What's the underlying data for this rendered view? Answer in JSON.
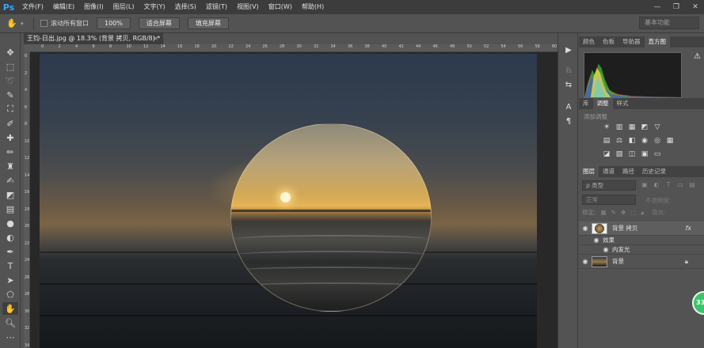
{
  "app": {
    "logo": "Ps"
  },
  "menu": [
    "文件(F)",
    "编辑(E)",
    "图像(I)",
    "图层(L)",
    "文字(Y)",
    "选择(S)",
    "滤镜(T)",
    "视图(V)",
    "窗口(W)",
    "帮助(H)"
  ],
  "window_controls": [
    "—",
    "❐",
    "✕"
  ],
  "options_bar": {
    "tool_icon": "hand-icon",
    "scroll_all_label": "滚动所有窗口",
    "zoom_value": "100%",
    "fit_screen_label": "适合屏幕",
    "fill_screen_label": "填充屏幕",
    "workspace_label": "基本功能"
  },
  "document": {
    "tab_title": "王钧-日出.jpg @ 18.3% (背景 拷贝, RGB/8) *",
    "close": "×"
  },
  "rulers": {
    "top": [
      "0",
      "2",
      "4",
      "6",
      "8",
      "10",
      "12",
      "14",
      "16",
      "18",
      "20",
      "22",
      "24",
      "26",
      "28",
      "30",
      "32",
      "34",
      "36",
      "38",
      "40",
      "42",
      "44",
      "46",
      "48",
      "50",
      "52",
      "54",
      "56",
      "58",
      "60"
    ],
    "left": [
      "0",
      "2",
      "4",
      "6",
      "8",
      "10",
      "12",
      "14",
      "16",
      "18",
      "20",
      "22",
      "24",
      "26",
      "28",
      "30",
      "32",
      "34"
    ]
  },
  "panels": {
    "top_tabs": [
      "颜色",
      "色板",
      "导航器",
      "直方图"
    ],
    "top_active": "直方图",
    "adjust_tabs": [
      "库",
      "调整",
      "样式"
    ],
    "adjust_active": "调整",
    "adjust_title": "添加调整",
    "layer_tabs": [
      "图层",
      "通道",
      "路径",
      "历史记录"
    ],
    "layer_active": "图层",
    "layer_filter": "ρ 类型",
    "blend_mode": "正常",
    "opacity_label": "不透明度:",
    "lock_label": "锁定:",
    "fill_label": "填充:",
    "layers": [
      {
        "name": "背景 拷贝",
        "fx": "fx"
      },
      {
        "name": "效果"
      },
      {
        "name": "内发光"
      },
      {
        "name": "背景"
      }
    ]
  },
  "badge": "33"
}
